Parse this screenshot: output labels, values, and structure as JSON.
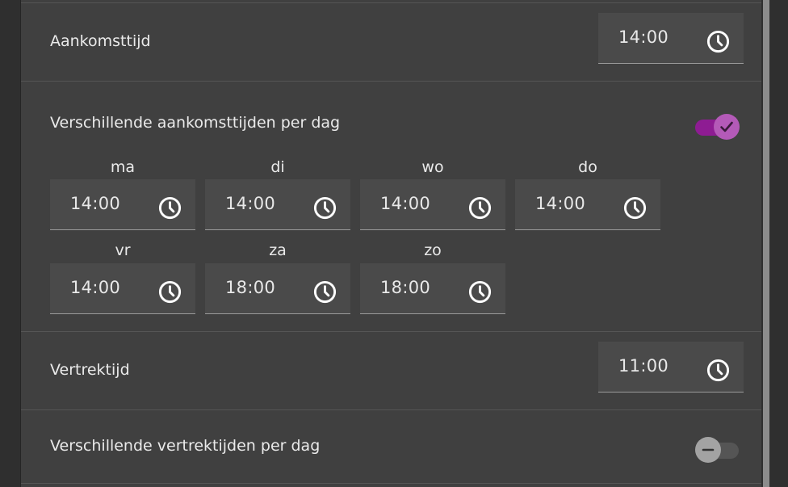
{
  "arrival": {
    "label": "Aankomsttijd",
    "time": "14:00"
  },
  "arrival_per_day": {
    "label": "Verschillende aankomsttijden per dag",
    "enabled": true,
    "days": [
      {
        "label": "ma",
        "time": "14:00"
      },
      {
        "label": "di",
        "time": "14:00"
      },
      {
        "label": "wo",
        "time": "14:00"
      },
      {
        "label": "do",
        "time": "14:00"
      },
      {
        "label": "vr",
        "time": "14:00"
      },
      {
        "label": "za",
        "time": "18:00"
      },
      {
        "label": "zo",
        "time": "18:00"
      }
    ]
  },
  "departure": {
    "label": "Vertrektijd",
    "time": "11:00"
  },
  "departure_per_day": {
    "label": "Verschillende vertrektijden per dag",
    "enabled": false
  },
  "icons": {
    "time": "clock-icon",
    "toggle_on": "check-icon",
    "toggle_off": "minus-icon"
  },
  "colors": {
    "accent": "#8e1c93",
    "accent_knob": "#b45ab8",
    "panel": "#404040",
    "field": "#4a4a4a"
  }
}
